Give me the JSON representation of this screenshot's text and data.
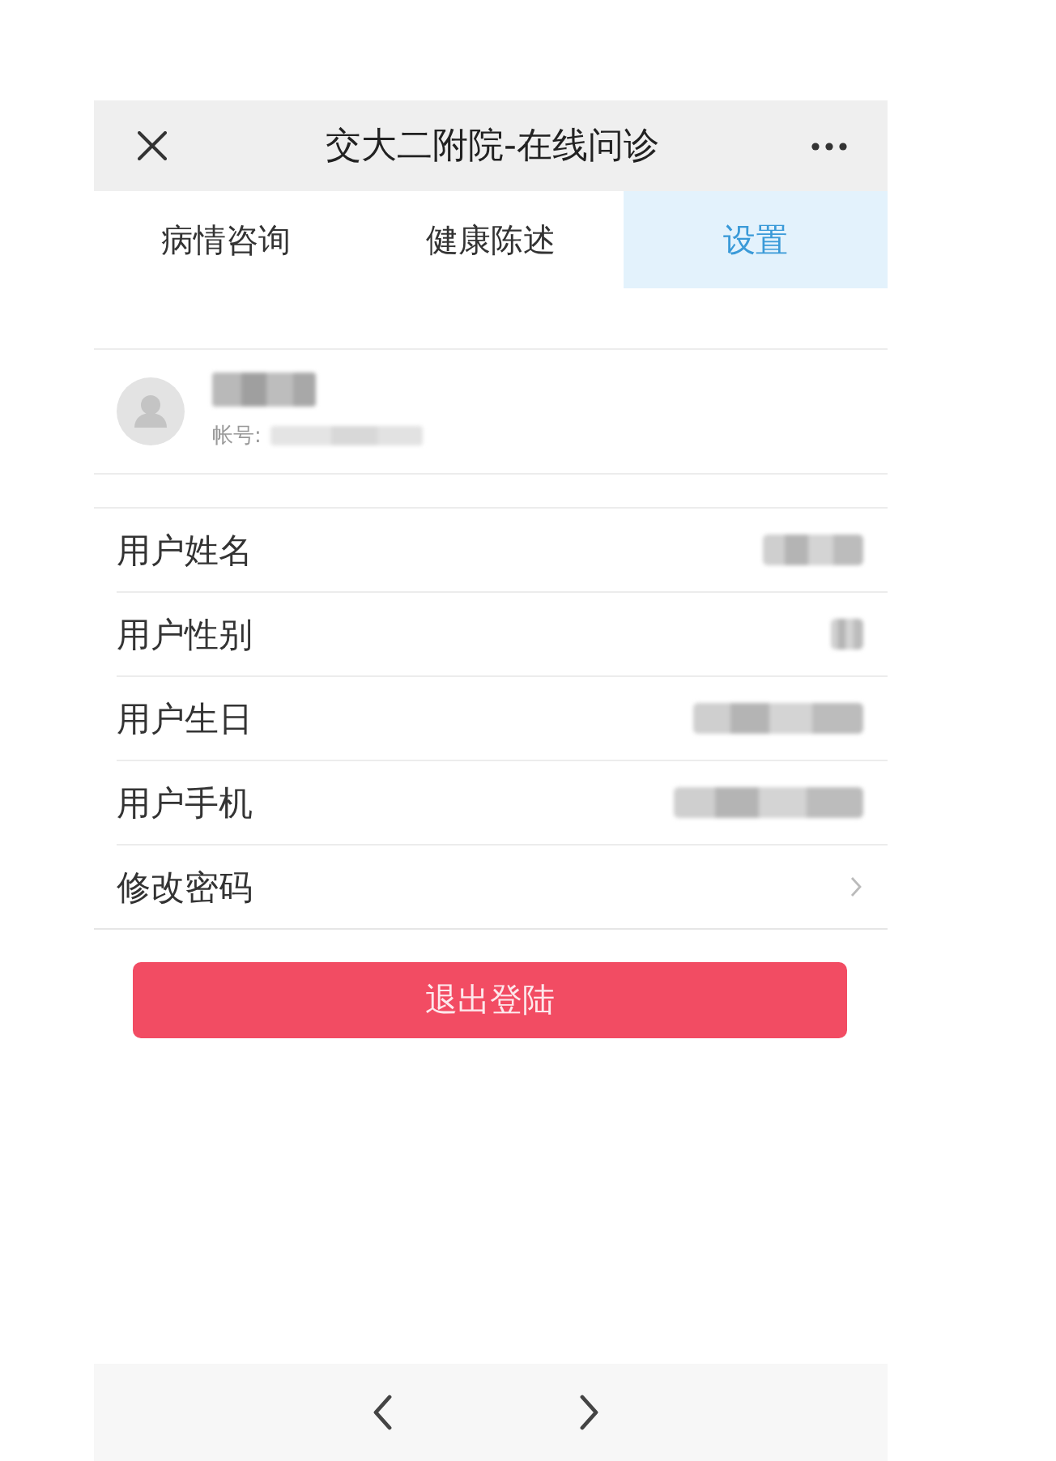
{
  "header": {
    "title": "交大二附院-在线问诊"
  },
  "tabs": [
    {
      "label": "病情咨询",
      "selected": false
    },
    {
      "label": "健康陈述",
      "selected": false
    },
    {
      "label": "设置",
      "selected": true
    }
  ],
  "profile": {
    "account_label": "帐号:"
  },
  "settings": [
    {
      "label": "用户姓名",
      "kind": "field"
    },
    {
      "label": "用户性别",
      "kind": "field"
    },
    {
      "label": "用户生日",
      "kind": "field"
    },
    {
      "label": "用户手机",
      "kind": "field"
    },
    {
      "label": "修改密码",
      "kind": "link"
    }
  ],
  "logout_button": {
    "label": "退出登陆"
  }
}
